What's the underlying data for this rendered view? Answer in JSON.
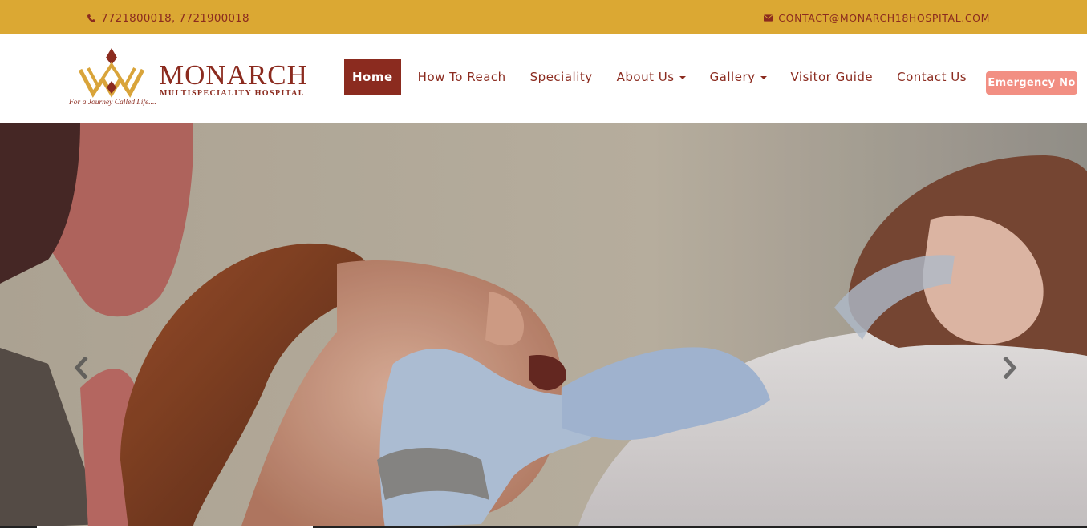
{
  "topbar": {
    "phone_icon": "phone-icon",
    "phone": "7721800018, 7721900018",
    "email_icon": "envelope-icon",
    "email": "CONTACT@MONARCH18HOSPITAL.COM"
  },
  "logo": {
    "brand": "MONARCH",
    "subtitle": "MULTISPECIALITY HOSPITAL",
    "tagline": "For a Journey Called Life....",
    "icon": "crown-logo-icon"
  },
  "nav": {
    "items": [
      {
        "label": "Home",
        "active": true
      },
      {
        "label": "How To Reach"
      },
      {
        "label": "Speciality"
      },
      {
        "label": "About Us",
        "dropdown": true
      },
      {
        "label": "Gallery",
        "dropdown": true
      },
      {
        "label": "Visitor Guide"
      },
      {
        "label": "Contact Us"
      }
    ],
    "emergency": "Emergency No"
  },
  "carousel": {
    "prev_icon": "chevron-left-icon",
    "next_icon": "chevron-right-icon",
    "image": "dentist-examining-patient-photo"
  },
  "colors": {
    "topbar_bg": "#dba833",
    "brand": "#8b2b1f",
    "emergency_bg": "#f28f83"
  }
}
